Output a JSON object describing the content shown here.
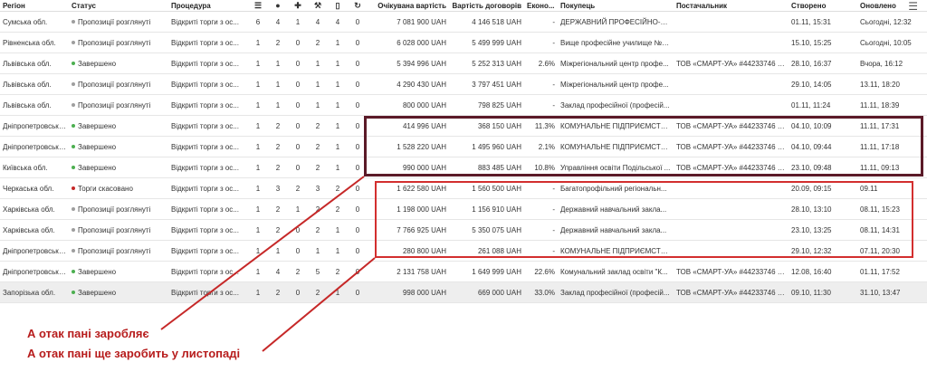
{
  "columns": {
    "region": "Регіон",
    "status": "Статус",
    "procedure": "Процедура",
    "expected": "Очікувана вартість",
    "contract": "Вартість договорів",
    "economy": "Еконо...",
    "buyer": "Покупець",
    "supplier": "Постачальник",
    "created": "Створено",
    "updated": "Оновлено"
  },
  "icons": [
    "list-icon",
    "user-icon",
    "user-plus-icon",
    "hammer-icon",
    "document-icon",
    "refresh-icon",
    "menu-icon"
  ],
  "colors": {
    "green": "#4caf50",
    "gray": "#9e9e9e",
    "red": "#c62828",
    "box_dark": "#5b1a28",
    "box_red": "#d32f2f",
    "caption": "#b71c1c"
  },
  "rows": [
    {
      "region": "Сумська обл.",
      "status": "Пропозиції розглянуті",
      "status_color": "gray",
      "procedure": "Відкриті торги з ос...",
      "n1": "6",
      "n2": "4",
      "n3": "1",
      "n4": "4",
      "n5": "4",
      "n6": "0",
      "expected": "7 081 900 UAH",
      "contract": "4 146 518 UAH",
      "economy": "-",
      "buyer": "ДЕРЖАВНИЙ ПРОФЕСІЙНО-ТЕ...",
      "supplier": "",
      "created": "01.11, 15:31",
      "updated": "Сьогодні, 12:32"
    },
    {
      "region": "Рівненська обл.",
      "status": "Пропозиції розглянуті",
      "status_color": "gray",
      "procedure": "Відкриті торги з ос...",
      "n1": "1",
      "n2": "2",
      "n3": "0",
      "n4": "2",
      "n5": "1",
      "n6": "0",
      "expected": "6 028 000 UAH",
      "contract": "5 499 999 UAH",
      "economy": "-",
      "buyer": "Вище професійне училище №2...",
      "supplier": "",
      "created": "15.10, 15:25",
      "updated": "Сьогодні, 10:05"
    },
    {
      "region": "Львівська обл.",
      "status": "Завершено",
      "status_color": "green",
      "procedure": "Відкриті торги з ос...",
      "n1": "1",
      "n2": "1",
      "n3": "0",
      "n4": "1",
      "n5": "1",
      "n6": "0",
      "expected": "5 394 996 UAH",
      "contract": "5 252 313 UAH",
      "economy": "2.6%",
      "buyer": "Міжрегіональний центр профе...",
      "supplier": "ТОВ «СМАРТ-УА» #44233746 — ...",
      "created": "28.10, 16:37",
      "updated": "Вчора, 16:12"
    },
    {
      "region": "Львівська обл.",
      "status": "Пропозиції розглянуті",
      "status_color": "gray",
      "procedure": "Відкриті торги з ос...",
      "n1": "1",
      "n2": "1",
      "n3": "0",
      "n4": "1",
      "n5": "1",
      "n6": "0",
      "expected": "4 290 430 UAH",
      "contract": "3 797 451 UAH",
      "economy": "-",
      "buyer": "Міжрегіональний центр профе...",
      "supplier": "",
      "created": "29.10, 14:05",
      "updated": "13.11, 18:20"
    },
    {
      "region": "Львівська обл.",
      "status": "Пропозиції розглянуті",
      "status_color": "gray",
      "procedure": "Відкриті торги з ос...",
      "n1": "1",
      "n2": "1",
      "n3": "0",
      "n4": "1",
      "n5": "1",
      "n6": "0",
      "expected": "800 000 UAH",
      "contract": "798 825 UAH",
      "economy": "-",
      "buyer": "Заклад професійної (професій...",
      "supplier": "",
      "created": "01.11, 11:24",
      "updated": "11.11, 18:39"
    },
    {
      "region": "Дніпропетровська ...",
      "status": "Завершено",
      "status_color": "green",
      "procedure": "Відкриті торги з ос...",
      "n1": "1",
      "n2": "2",
      "n3": "0",
      "n4": "2",
      "n5": "1",
      "n6": "0",
      "expected": "414 996 UAH",
      "contract": "368 150 UAH",
      "economy": "11.3%",
      "buyer": "КОМУНАЛЬНЕ ПІДПРИЄМСТВ...",
      "supplier": "ТОВ «СМАРТ-УА» #44233746 — ...",
      "created": "04.10, 10:09",
      "updated": "11.11, 17:31"
    },
    {
      "region": "Дніпропетровська ...",
      "status": "Завершено",
      "status_color": "green",
      "procedure": "Відкриті торги з ос...",
      "n1": "1",
      "n2": "2",
      "n3": "0",
      "n4": "2",
      "n5": "1",
      "n6": "0",
      "expected": "1 528 220 UAH",
      "contract": "1 495 960 UAH",
      "economy": "2.1%",
      "buyer": "КОМУНАЛЬНЕ ПІДПРИЄМСТВ...",
      "supplier": "ТОВ «СМАРТ-УА» #44233746 — ...",
      "created": "04.10, 09:44",
      "updated": "11.11, 17:18"
    },
    {
      "region": "Київська обл.",
      "status": "Завершено",
      "status_color": "green",
      "procedure": "Відкриті торги з ос...",
      "n1": "1",
      "n2": "2",
      "n3": "0",
      "n4": "2",
      "n5": "1",
      "n6": "0",
      "expected": "990 000 UAH",
      "contract": "883 485 UAH",
      "economy": "10.8%",
      "buyer": "Управління освіти Подільської ...",
      "supplier": "ТОВ «СМАРТ-УА» #44233746 — ...",
      "created": "23.10, 09:48",
      "updated": "11.11, 09:13"
    },
    {
      "region": "Черкаська обл.",
      "status": "Торги скасовано",
      "status_color": "red",
      "procedure": "Відкриті торги з ос...",
      "n1": "1",
      "n2": "3",
      "n3": "2",
      "n4": "3",
      "n5": "2",
      "n6": "0",
      "expected": "1 622 580 UAH",
      "contract": "1 560 500 UAH",
      "economy": "-",
      "buyer": "Багатопрофільний регіональн...",
      "supplier": "",
      "created": "20.09, 09:15",
      "updated": "09.11"
    },
    {
      "region": "Харківська обл.",
      "status": "Пропозиції розглянуті",
      "status_color": "gray",
      "procedure": "Відкриті торги з ос...",
      "n1": "1",
      "n2": "2",
      "n3": "1",
      "n4": "2",
      "n5": "2",
      "n6": "0",
      "expected": "1 198 000 UAH",
      "contract": "1 156 910 UAH",
      "economy": "-",
      "buyer": "Державний навчальний закла...",
      "supplier": "",
      "created": "28.10, 13:10",
      "updated": "08.11, 15:23"
    },
    {
      "region": "Харківська обл.",
      "status": "Пропозиції розглянуті",
      "status_color": "gray",
      "procedure": "Відкриті торги з ос...",
      "n1": "1",
      "n2": "2",
      "n3": "0",
      "n4": "2",
      "n5": "1",
      "n6": "0",
      "expected": "7 766 925 UAH",
      "contract": "5 350 075 UAH",
      "economy": "-",
      "buyer": "Державний навчальний закла...",
      "supplier": "",
      "created": "23.10, 13:25",
      "updated": "08.11, 14:31"
    },
    {
      "region": "Дніпропетровська ...",
      "status": "Пропозиції розглянуті",
      "status_color": "gray",
      "procedure": "Відкриті торги з ос...",
      "n1": "1",
      "n2": "1",
      "n3": "0",
      "n4": "1",
      "n5": "1",
      "n6": "0",
      "expected": "280 800 UAH",
      "contract": "261 088 UAH",
      "economy": "-",
      "buyer": "КОМУНАЛЬНЕ ПІДПРИЄМСТВ...",
      "supplier": "",
      "created": "29.10, 12:32",
      "updated": "07.11, 20:30"
    },
    {
      "region": "Дніпропетровська ...",
      "status": "Завершено",
      "status_color": "green",
      "procedure": "Відкриті торги з ос...",
      "n1": "1",
      "n2": "4",
      "n3": "2",
      "n4": "5",
      "n5": "2",
      "n6": "0",
      "expected": "2 131 758 UAH",
      "contract": "1 649 999 UAH",
      "economy": "22.6%",
      "buyer": "Комунальний заклад освіти \"К...",
      "supplier": "ТОВ «СМАРТ-УА» #44233746 — ...",
      "created": "12.08, 16:40",
      "updated": "01.11, 17:52"
    },
    {
      "region": "Запорізька обл.",
      "status": "Завершено",
      "status_color": "green",
      "procedure": "Відкриті торги з ос...",
      "n1": "1",
      "n2": "2",
      "n3": "0",
      "n4": "2",
      "n5": "1",
      "n6": "0",
      "expected": "998 000 UAH",
      "contract": "669 000 UAH",
      "economy": "33.0%",
      "buyer": "Заклад професійної (професій...",
      "supplier": "ТОВ «СМАРТ-УА» #44233746 — ...",
      "created": "09.10, 11:30",
      "updated": "31.10, 13:47"
    }
  ],
  "captions": {
    "line1": "А отак пані заробляє",
    "line2": "А отак пані ще заробить у листопаді"
  }
}
